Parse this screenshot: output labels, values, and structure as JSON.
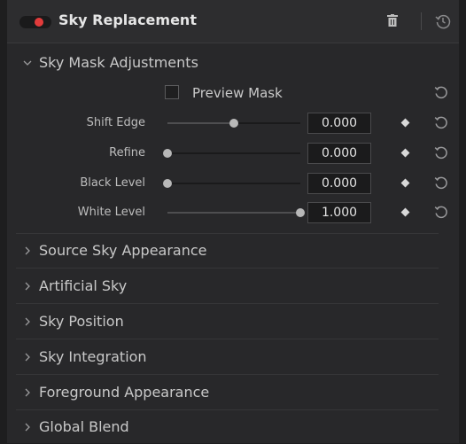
{
  "header": {
    "title": "Sky Replacement"
  },
  "open_section": {
    "title": "Sky Mask Adjustments",
    "preview_mask_label": "Preview Mask",
    "preview_mask_checked": false,
    "rows": [
      {
        "label": "Shift Edge",
        "value": "0.000",
        "level": 0.5
      },
      {
        "label": "Refine",
        "value": "0.000",
        "level": 0.0
      },
      {
        "label": "Black Level",
        "value": "0.000",
        "level": 0.0
      },
      {
        "label": "White Level",
        "value": "1.000",
        "level": 1.0
      }
    ]
  },
  "collapsed_sections": [
    "Source Sky Appearance",
    "Artificial Sky",
    "Sky Position",
    "Sky Integration",
    "Foreground Appearance",
    "Global Blend"
  ],
  "colors": {
    "accent_toggle": "#e23b3b",
    "panel": "#28282a"
  }
}
